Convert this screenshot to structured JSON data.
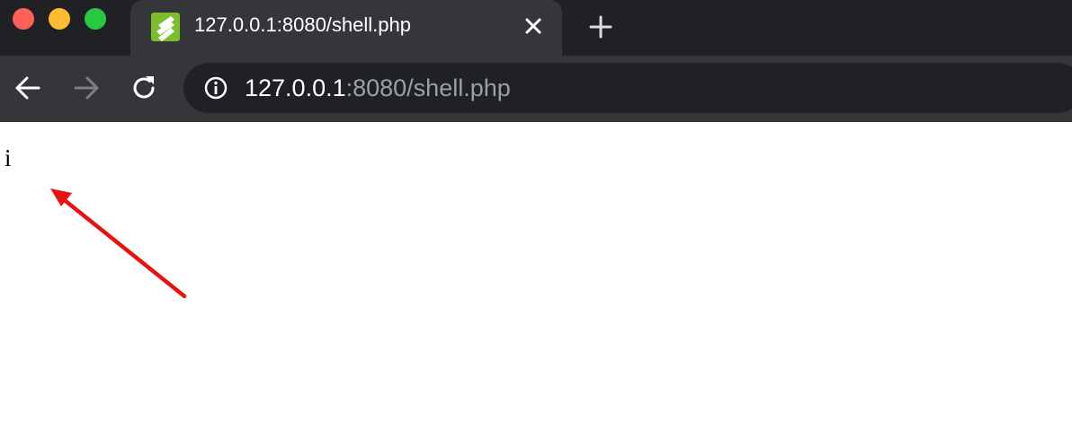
{
  "window": {
    "traffic_lights": [
      "close",
      "minimize",
      "maximize"
    ]
  },
  "tab": {
    "title": "127.0.0.1:8080/shell.php",
    "favicon": "striped-leaf-favicon-icon",
    "favicon_color": "#7cbd2e"
  },
  "toolbar": {
    "url_host": "127.0.0.1",
    "url_rest": ":8080/shell.php"
  },
  "page": {
    "body_text": "i"
  },
  "annotation": {
    "type": "red-arrow",
    "color": "#e8130f"
  },
  "colors": {
    "tabstrip_bg": "#202124",
    "toolbar_bg": "#35363a",
    "omnibox_bg": "#202124"
  }
}
